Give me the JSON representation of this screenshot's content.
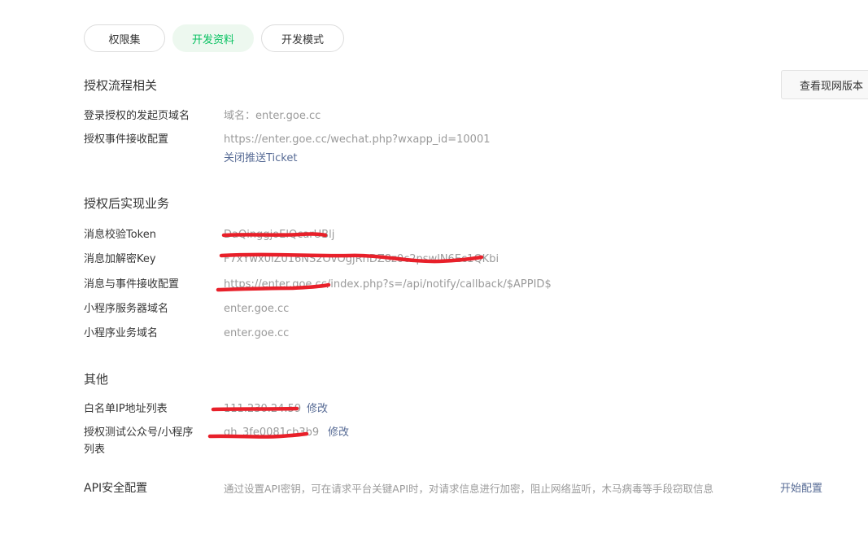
{
  "tabs": [
    {
      "label": "权限集"
    },
    {
      "label": "开发资料",
      "active": true
    },
    {
      "label": "开发模式"
    }
  ],
  "history_button": "查看现网版本",
  "sections": {
    "auth_flow": {
      "title": "授权流程相关",
      "login_domain_label": "登录授权的发起页域名",
      "login_domain_value": "域名：enter.goe.cc",
      "event_config_label": "授权事件接收配置",
      "event_config_value": "https://enter.goe.cc/wechat.php?wxapp_id=10001",
      "close_ticket_link": "关闭推送Ticket"
    },
    "business": {
      "title": "授权后实现业务",
      "token_label": "消息校验Token",
      "token_value": "DaQinggjoElQcarUBlj",
      "key_label": "消息加解密Key",
      "key_value": "F7xYwx0iZ016NS2OvOgjRnDZ8z0c2pswlN6Ec1QKbi",
      "msg_config_label": "消息与事件接收配置",
      "msg_config_value": "https://enter.goe.cc/index.php?s=/api/notify/callback/$APPID$",
      "server_domain_label": "小程序服务器域名",
      "server_domain_value": "enter.goe.cc",
      "biz_domain_label": "小程序业务域名",
      "biz_domain_value": "enter.goe.cc"
    },
    "other": {
      "title": "其他",
      "whitelist_label": "白名单IP地址列表",
      "whitelist_value": "111.230.24.59",
      "whitelist_edit": "修改",
      "test_account_label": "授权测试公众号/小程序列表",
      "test_account_value": "gh_3fe0081cb3b9",
      "test_account_edit": "修改"
    },
    "api_security": {
      "label": "API安全配置",
      "description": "通过设置API密钥，可在请求平台关键API时，对请求信息进行加密，阻止网络监听，木马病毒等手段窃取信息",
      "start_link": "开始配置"
    }
  },
  "colors": {
    "accent_green": "#07c160",
    "link_blue": "#576b95",
    "redaction_red": "#e8202a"
  }
}
